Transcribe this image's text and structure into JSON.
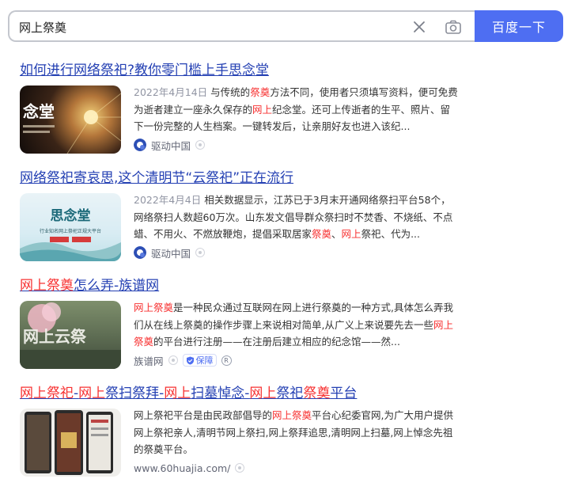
{
  "search": {
    "query": "网上祭奠",
    "button_label": "百度一下"
  },
  "results": [
    {
      "title_parts": [
        "如何进行网络祭祀?教你零门槛上手思念堂"
      ],
      "thumb_text": "念堂",
      "date": "2022年4月14日",
      "abstract_parts": [
        "与传统的",
        "祭奠",
        "方法不同，使用者只须填写资料，便可免费为逝者建立一座永久保存的",
        "网上",
        "纪念堂。还可上传逝者的生平、照片、留下一份完整的人生档案。一键转发后，让亲朋好友也进入该纪..."
      ],
      "source": "驱动中国"
    },
    {
      "title_parts": [
        "网络祭祀寄哀思,这个清明节“云祭祀”正在流行"
      ],
      "thumb_text": "思念堂",
      "thumb_sub": "行业知名网上祭祀正规大平台",
      "date": "2022年4月4日",
      "abstract_parts": [
        "相关数据显示，江苏已于3月末开通网络祭扫平台58个，网络祭扫人数超60万次。山东发文倡导群众祭扫时不焚香、不烧纸、不点蜡、不用火、不燃放鞭炮，提倡采取居家",
        "祭奠",
        "、",
        "网上",
        "祭祀、代为..."
      ],
      "source": "驱动中国"
    },
    {
      "title_parts": [
        "网上祭奠",
        "怎么弄-族谱网"
      ],
      "thumb_text": "网上云祭",
      "abstract_parts": [
        "网上祭奠",
        "是一种民众通过互联网在网上进行祭奠的一种方式,具体怎么弄我们从在线上祭奠的操作步骤上来说相对简单,从广义上来说要先去一些",
        "网上祭奠",
        "的平台进行注册——在注册后建立相应的纪念馆——然..."
      ],
      "source": "族谱网",
      "badge": "保障",
      "r_mark": "R"
    },
    {
      "title_parts": [
        "网上祭祀",
        "-",
        "网上",
        "祭扫祭拜-",
        "网上",
        "扫墓悼念-",
        "网上",
        "祭祀",
        "祭奠",
        "平台"
      ],
      "abstract_parts": [
        "网上祭祀平台是由民政部倡导的",
        "网上祭奠",
        "平台心纪委官网,为广大用户提供网上祭祀亲人,清明节网上祭扫,网上祭拜追思,清明网上扫墓,网上悼念先祖的祭奠平台。"
      ],
      "source": "www.60huajia.com/"
    }
  ],
  "colors": {
    "link": "#2440b3",
    "highlight": "#f73131",
    "button": "#4e6ef2"
  }
}
